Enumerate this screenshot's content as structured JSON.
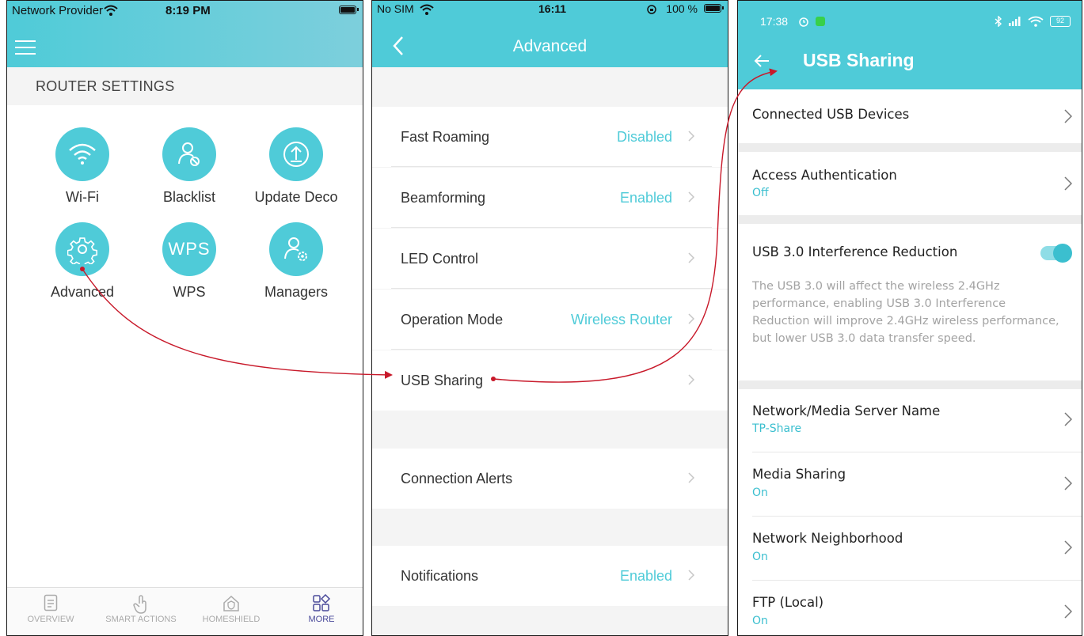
{
  "phone1": {
    "status": {
      "carrier": "Network Provider",
      "time": "8:19 PM"
    },
    "section_title": "ROUTER SETTINGS",
    "grid": [
      {
        "label": "Wi-Fi",
        "icon": "wifi-icon"
      },
      {
        "label": "Blacklist",
        "icon": "user-block-icon"
      },
      {
        "label": "Update Deco",
        "icon": "upload-icon"
      },
      {
        "label": "Advanced",
        "icon": "gear-icon"
      },
      {
        "label": "WPS",
        "icon": "wps-icon"
      },
      {
        "label": "Managers",
        "icon": "user-gear-icon"
      }
    ],
    "tabs": [
      {
        "label": "OVERVIEW",
        "icon": "document-icon"
      },
      {
        "label": "SMART ACTIONS",
        "icon": "tap-icon"
      },
      {
        "label": "HOMESHIELD",
        "icon": "home-shield-icon"
      },
      {
        "label": "MORE",
        "icon": "grid-more-icon"
      }
    ],
    "accent": "#4fcbd8"
  },
  "phone2": {
    "status": {
      "carrier": "No SIM",
      "time": "16:11",
      "battery": "100 %"
    },
    "title": "Advanced",
    "rows": [
      {
        "label": "Fast Roaming",
        "value": "Disabled"
      },
      {
        "label": "Beamforming",
        "value": "Enabled"
      },
      {
        "label": "LED Control",
        "value": ""
      },
      {
        "label": "Operation Mode",
        "value": "Wireless Router"
      },
      {
        "label": "USB Sharing",
        "value": ""
      },
      {
        "label": "Connection Alerts",
        "value": ""
      },
      {
        "label": "Notifications",
        "value": "Enabled"
      }
    ]
  },
  "phone3": {
    "status": {
      "time": "17:38",
      "battery": "92"
    },
    "title": "USB Sharing",
    "rows": {
      "connected": {
        "label": "Connected USB Devices"
      },
      "auth": {
        "label": "Access Authentication",
        "value": "Off"
      },
      "interference": {
        "label": "USB 3.0 Interference Reduction",
        "enabled": true
      },
      "description": "The USB 3.0 will affect the wireless 2.4GHz performance, enabling USB 3.0 Interference Reduction will improve 2.4GHz wireless performance, but lower USB 3.0 data transfer speed.",
      "server": {
        "label": "Network/Media Server Name",
        "value": "TP-Share"
      },
      "media": {
        "label": "Media Sharing",
        "value": "On"
      },
      "neighborhood": {
        "label": "Network Neighborhood",
        "value": "On"
      },
      "ftp": {
        "label": "FTP (Local)",
        "value": "On"
      }
    }
  },
  "annotation_color": "#c8192a"
}
